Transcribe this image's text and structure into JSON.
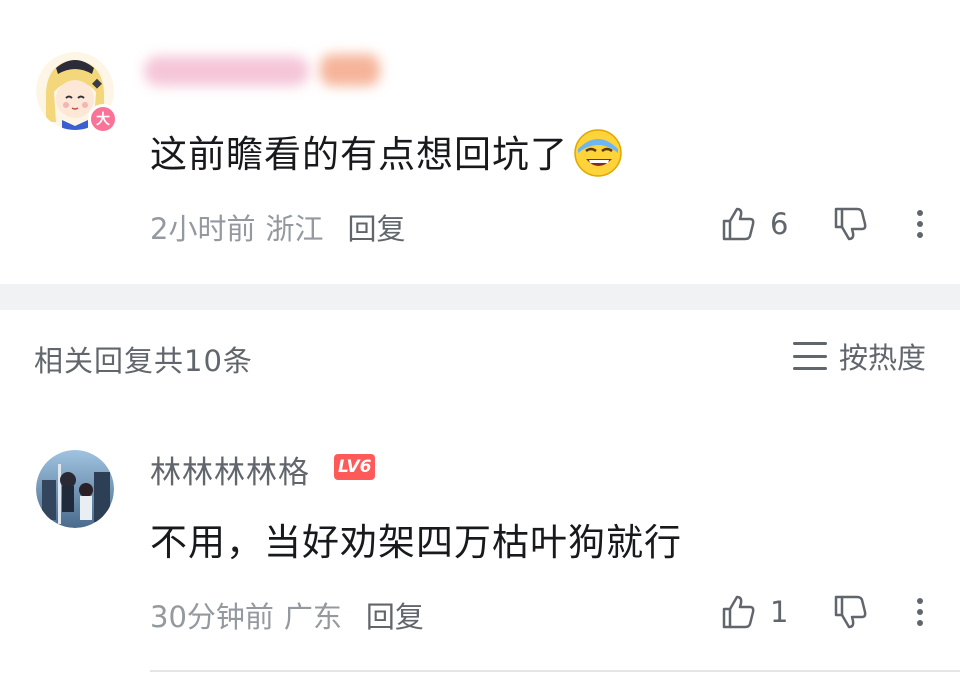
{
  "comment_main": {
    "avatar_badge": "大",
    "text": "这前瞻看的有点想回坑了",
    "emoji": "grinning-sweat-emoji",
    "time": "2小时前",
    "region": "浙江",
    "reply_label": "回复",
    "like_count": "6"
  },
  "replies_header": {
    "title": "相关回复共10条",
    "sort_label": "按热度"
  },
  "reply_1": {
    "username": "林林林林格",
    "level": "LV6",
    "text": "不用，当好劝架四万枯叶狗就行",
    "time": "30分钟前",
    "region": "广东",
    "reply_label": "回复",
    "like_count": "1"
  },
  "colors": {
    "accent_pink": "#fb7299",
    "level_red": "#ff5a5a",
    "text_primary": "#18191c",
    "text_secondary": "#9499a0"
  }
}
